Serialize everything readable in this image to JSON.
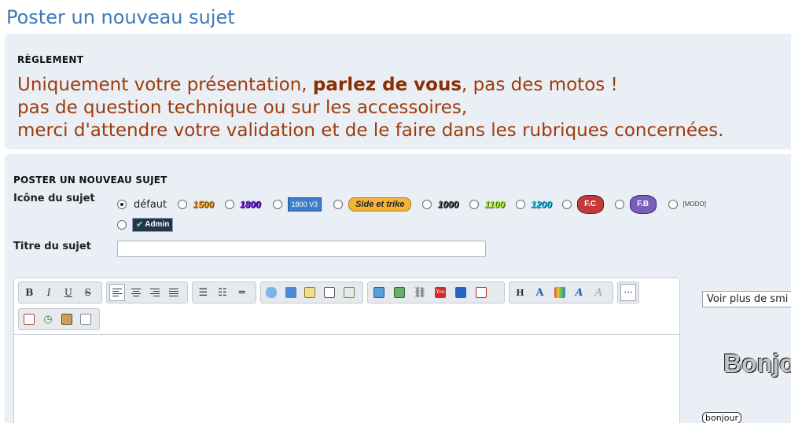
{
  "page": {
    "title": "Poster un nouveau sujet"
  },
  "rules": {
    "heading": "RÈGLEMENT",
    "line1_a": "Uniquement votre présentation, ",
    "line1_b": "parlez de vous",
    "line1_c": ", pas des motos !",
    "line2": "pas de question technique ou sur les accessoires,",
    "line3": "merci d'attendre votre validation et de le faire dans les rubriques concernées."
  },
  "post": {
    "heading": "POSTER UN NOUVEAU SUJET",
    "icon_label": "Icône du sujet",
    "title_label": "Titre du sujet",
    "title_value": ""
  },
  "icons": {
    "default": "défaut",
    "i1500": "1500",
    "i1800": "1800",
    "v3": "1800 V3",
    "side": "Side et trike",
    "i1000": "1000",
    "i1100": "1100",
    "i1200": "1200",
    "fc": "F.C",
    "fb": "F.B",
    "modo": "[MODO]",
    "admin": "Admin"
  },
  "toolbar": {
    "bold": "B",
    "italic": "I",
    "underline": "U",
    "strike": "S",
    "heading": "H"
  },
  "sidebar": {
    "more_smilies": "Voir plus de smi",
    "bonjour_big": "Bonjo",
    "bonjour_small": "bonjour"
  }
}
